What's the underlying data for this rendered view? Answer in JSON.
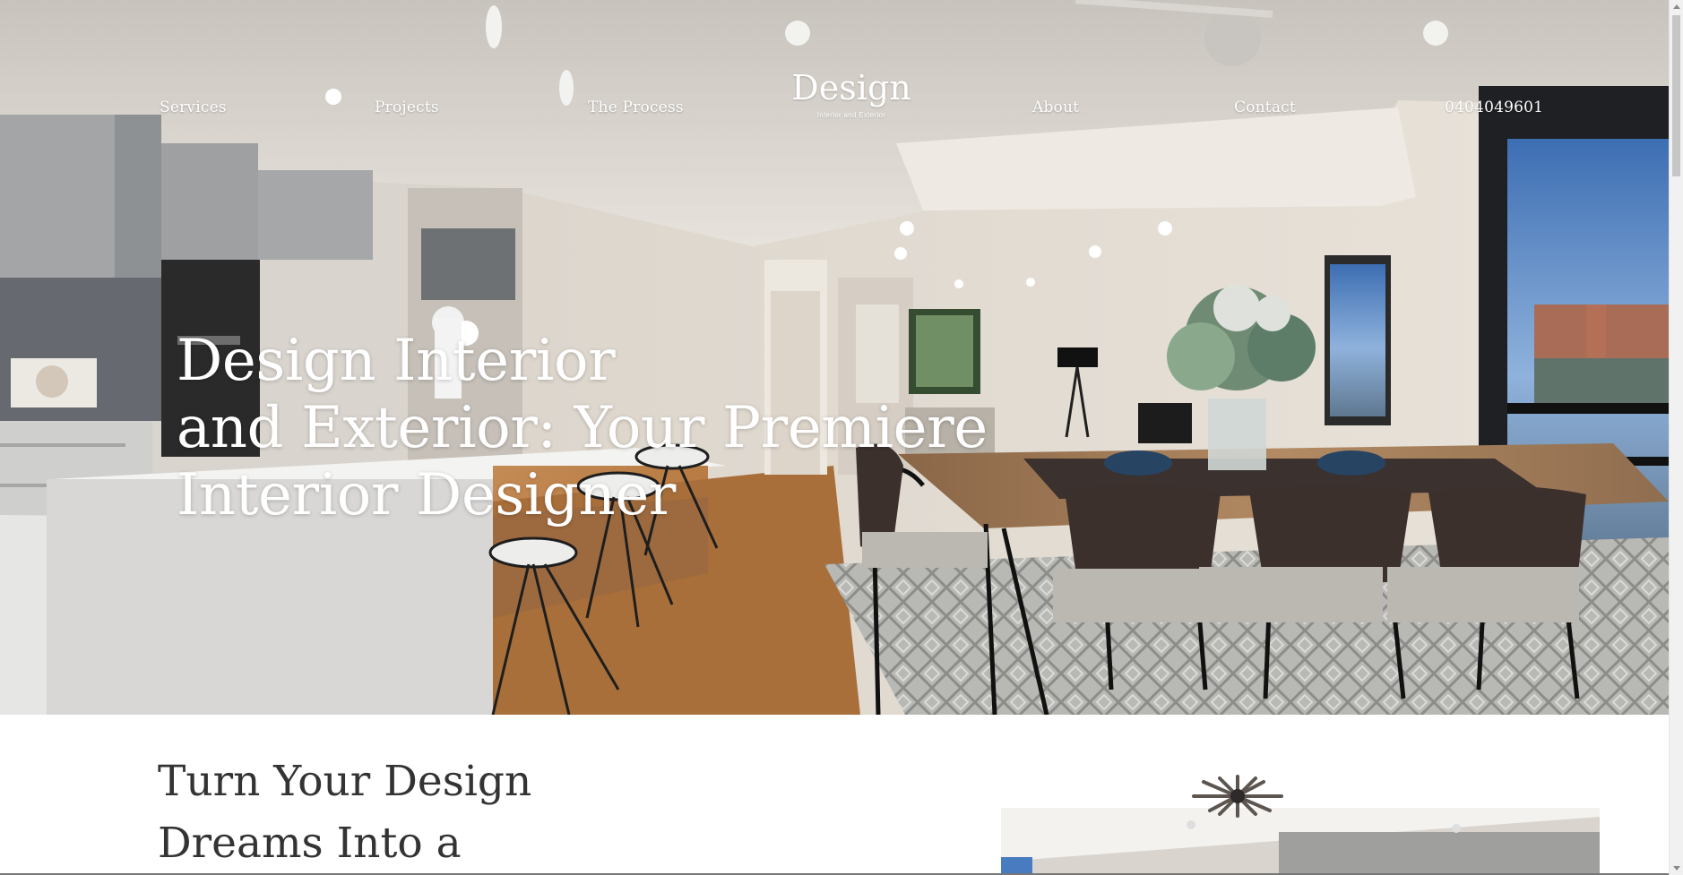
{
  "nav": {
    "services": "Services",
    "projects": "Projects",
    "process": "The Process",
    "about": "About",
    "contact": "Contact",
    "phone": "0404049601"
  },
  "logo": {
    "title": "Design",
    "subtitle": "Interior and Exterior"
  },
  "hero": {
    "headline_lines": [
      "Design Interior",
      "and Exterior: Your Premiere",
      "Interior Designer"
    ]
  },
  "intro": {
    "heading_lines": [
      "Turn Your Design",
      "Dreams Into a"
    ]
  }
}
